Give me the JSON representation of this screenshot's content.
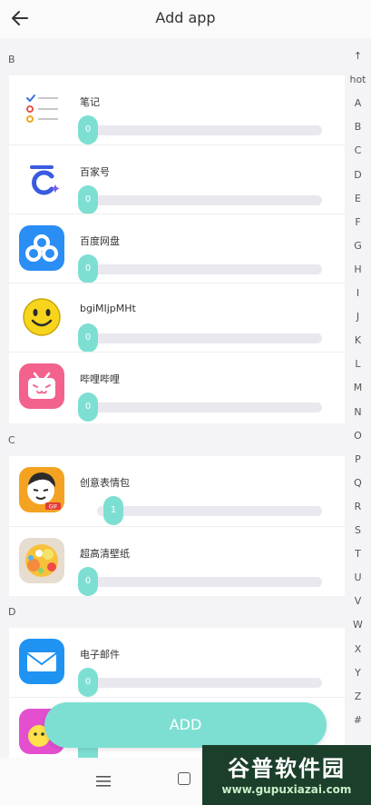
{
  "header": {
    "title": "Add app"
  },
  "sections": [
    {
      "letter": "B",
      "apps": [
        {
          "name": "笔记",
          "value": "0"
        },
        {
          "name": "百家号",
          "value": "0"
        },
        {
          "name": "百度网盘",
          "value": "0"
        },
        {
          "name": "bgiMIjpMHt",
          "value": "0"
        },
        {
          "name": "哔哩哔哩",
          "value": "0"
        }
      ]
    },
    {
      "letter": "C",
      "apps": [
        {
          "name": "创意表情包",
          "value": "1"
        },
        {
          "name": "超高清壁纸",
          "value": "0"
        }
      ]
    },
    {
      "letter": "D",
      "apps": [
        {
          "name": "电子邮件",
          "value": "0"
        },
        {
          "name": "",
          "value": ""
        }
      ]
    }
  ],
  "index_bar": [
    "↑",
    "hot",
    "A",
    "B",
    "C",
    "D",
    "E",
    "F",
    "G",
    "H",
    "I",
    "J",
    "K",
    "L",
    "M",
    "N",
    "O",
    "P",
    "Q",
    "R",
    "S",
    "T",
    "U",
    "V",
    "W",
    "X",
    "Y",
    "Z",
    "#"
  ],
  "add_button": "ADD",
  "watermark": {
    "title": "谷普软件园",
    "url": "www.gupuxiazai.com"
  },
  "colors": {
    "accent": "#7ddfd2",
    "track": "#e8e8ee",
    "background": "#f4f4f6"
  },
  "icons": [
    "back-arrow-icon",
    "notes-icon",
    "baijiahao-icon",
    "baidu-netdisk-icon",
    "smiley-icon",
    "bilibili-icon",
    "meme-icon",
    "wallpaper-icon",
    "email-icon",
    "menu-icon",
    "home-icon"
  ]
}
